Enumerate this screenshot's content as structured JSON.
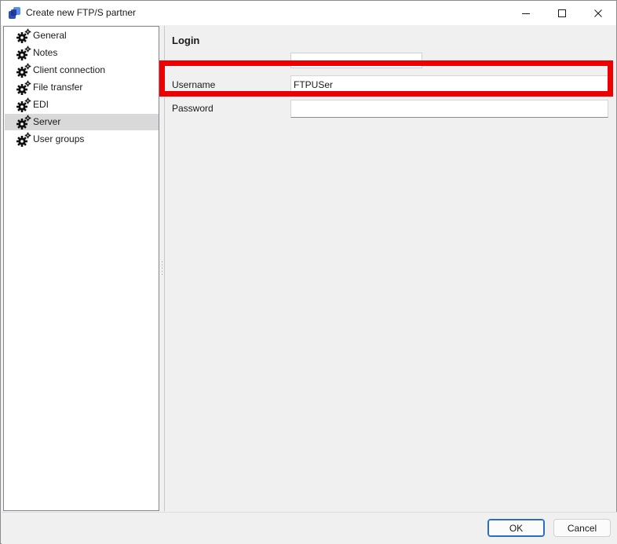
{
  "window": {
    "title": "Create new FTP/S partner",
    "accent_color": "#2a6ec4"
  },
  "sidebar": {
    "items": [
      {
        "label": "General",
        "icon": "gear-icon",
        "selected": false
      },
      {
        "label": "Notes",
        "icon": "gear-icon",
        "selected": false
      },
      {
        "label": "Client connection",
        "icon": "gear-icon",
        "selected": false
      },
      {
        "label": "File transfer",
        "icon": "gear-icon",
        "selected": false
      },
      {
        "label": "EDI",
        "icon": "gear-icon",
        "selected": false
      },
      {
        "label": "Server",
        "icon": "gear-icon",
        "selected": true
      },
      {
        "label": "User groups",
        "icon": "gear-icon",
        "selected": false
      }
    ]
  },
  "login": {
    "section_title": "Login",
    "username_label": "Username",
    "username_value": "FTPUSer",
    "password_label": "Password",
    "password_value": ""
  },
  "annotation": {
    "highlight_color": "#ee0000"
  },
  "footer": {
    "ok_label": "OK",
    "cancel_label": "Cancel"
  }
}
